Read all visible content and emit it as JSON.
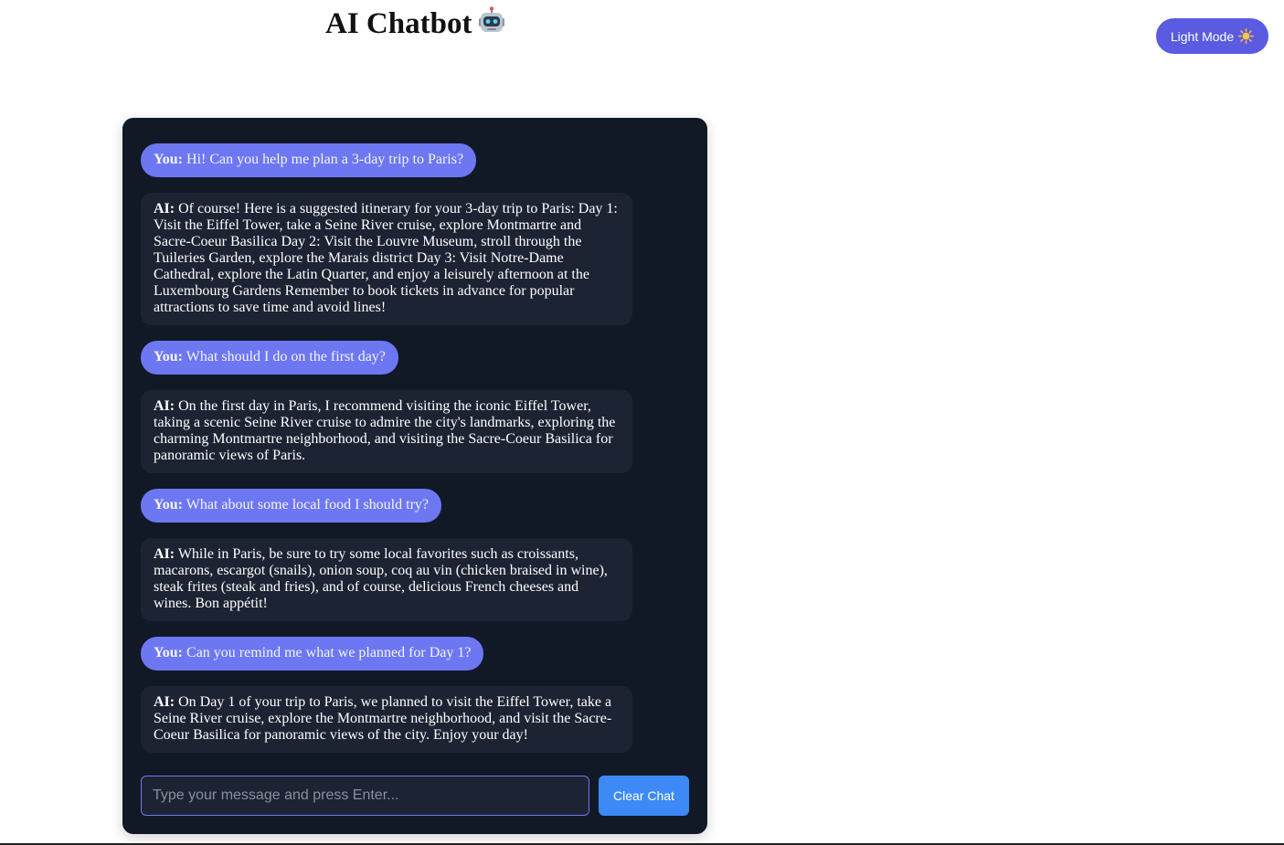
{
  "header": {
    "title": "AI Chatbot",
    "title_icon": "robot-emoji-icon"
  },
  "theme_toggle": {
    "label": "Light Mode",
    "icon": "sun-icon",
    "color": "#5a5be0"
  },
  "chat": {
    "background": "#111926",
    "messages": [
      {
        "role": "user",
        "prefix": "You:",
        "text": "Hi! Can you help me plan a 3-day trip to Paris?"
      },
      {
        "role": "ai",
        "prefix": "AI:",
        "text": "Of course! Here is a suggested itinerary for your 3-day trip to Paris: Day 1: Visit the Eiffel Tower, take a Seine River cruise, explore Montmartre and Sacre-Coeur Basilica Day 2: Visit the Louvre Museum, stroll through the Tuileries Garden, explore the Marais district Day 3: Visit Notre-Dame Cathedral, explore the Latin Quarter, and enjoy a leisurely afternoon at the Luxembourg Gardens Remember to book tickets in advance for popular attractions to save time and avoid lines!"
      },
      {
        "role": "user",
        "prefix": "You:",
        "text": "What should I do on the first day?"
      },
      {
        "role": "ai",
        "prefix": "AI:",
        "text": "On the first day in Paris, I recommend visiting the iconic Eiffel Tower, taking a scenic Seine River cruise to admire the city's landmarks, exploring the charming Montmartre neighborhood, and visiting the Sacre-Coeur Basilica for panoramic views of Paris."
      },
      {
        "role": "user",
        "prefix": "You:",
        "text": "What about some local food I should try?"
      },
      {
        "role": "ai",
        "prefix": "AI:",
        "text": "While in Paris, be sure to try some local favorites such as croissants, macarons, escargot (snails), onion soup, coq au vin (chicken braised in wine), steak frites (steak and fries), and of course, delicious French cheeses and wines. Bon appétit!"
      },
      {
        "role": "user",
        "prefix": "You:",
        "text": "Can you remind me what we planned for Day 1?"
      },
      {
        "role": "ai",
        "prefix": "AI:",
        "text": "On Day 1 of your trip to Paris, we planned to visit the Eiffel Tower, take a Seine River cruise, explore the Montmartre neighborhood, and visit the Sacre-Coeur Basilica for panoramic views of the city. Enjoy your day!"
      }
    ],
    "input": {
      "value": "",
      "placeholder": "Type your message and press Enter..."
    },
    "clear_button_label": "Clear Chat",
    "user_bubble_color": "#6d77f2",
    "ai_bubble_color": "#1c2333",
    "clear_button_color": "#3d8af7"
  }
}
